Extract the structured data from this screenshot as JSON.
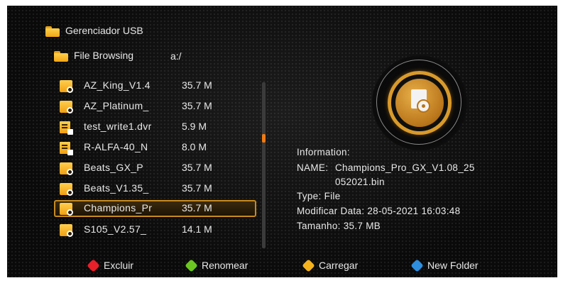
{
  "header": {
    "title": "Gerenciador USB"
  },
  "browser": {
    "label": "File Browsing",
    "path": "a:/"
  },
  "files": [
    {
      "name": "AZ_King_V1.4",
      "size": "35.7 M",
      "type": "folder"
    },
    {
      "name": "AZ_Platinum_",
      "size": "35.7 M",
      "type": "folder"
    },
    {
      "name": "test_write1.dvr",
      "size": "5.9 M",
      "type": "doc"
    },
    {
      "name": "R-ALFA-40_N",
      "size": "8.0 M",
      "type": "doc"
    },
    {
      "name": "Beats_GX_P",
      "size": "35.7 M",
      "type": "folder"
    },
    {
      "name": "Beats_V1.35_",
      "size": "35.7 M",
      "type": "folder"
    },
    {
      "name": "Champions_Pr",
      "size": "35.7 M",
      "type": "folder",
      "selected": true
    },
    {
      "name": "S105_V2.57_",
      "size": "14.1 M",
      "type": "folder"
    }
  ],
  "info": {
    "heading": "Information:",
    "name_label": "NAME:",
    "name_line1": "Champions_Pro_GX_V1.08_25",
    "name_line2": "052021.bin",
    "type": "Type: File",
    "modified": "Modificar Data: 28-05-2021 16:03:48",
    "size": "Tamanho: 35.7 MB"
  },
  "footer": [
    {
      "label": "Excluir",
      "color": "#e8202a"
    },
    {
      "label": "Renomear",
      "color": "#6cc622"
    },
    {
      "label": "Carregar",
      "color": "#f5b21c"
    },
    {
      "label": "New Folder",
      "color": "#2e8fe0"
    }
  ],
  "scroll": {
    "position_fraction": 0.33
  },
  "icons": {
    "folder": "folder-icon",
    "file": "file-document-icon",
    "preview": "file-preview-icon"
  }
}
